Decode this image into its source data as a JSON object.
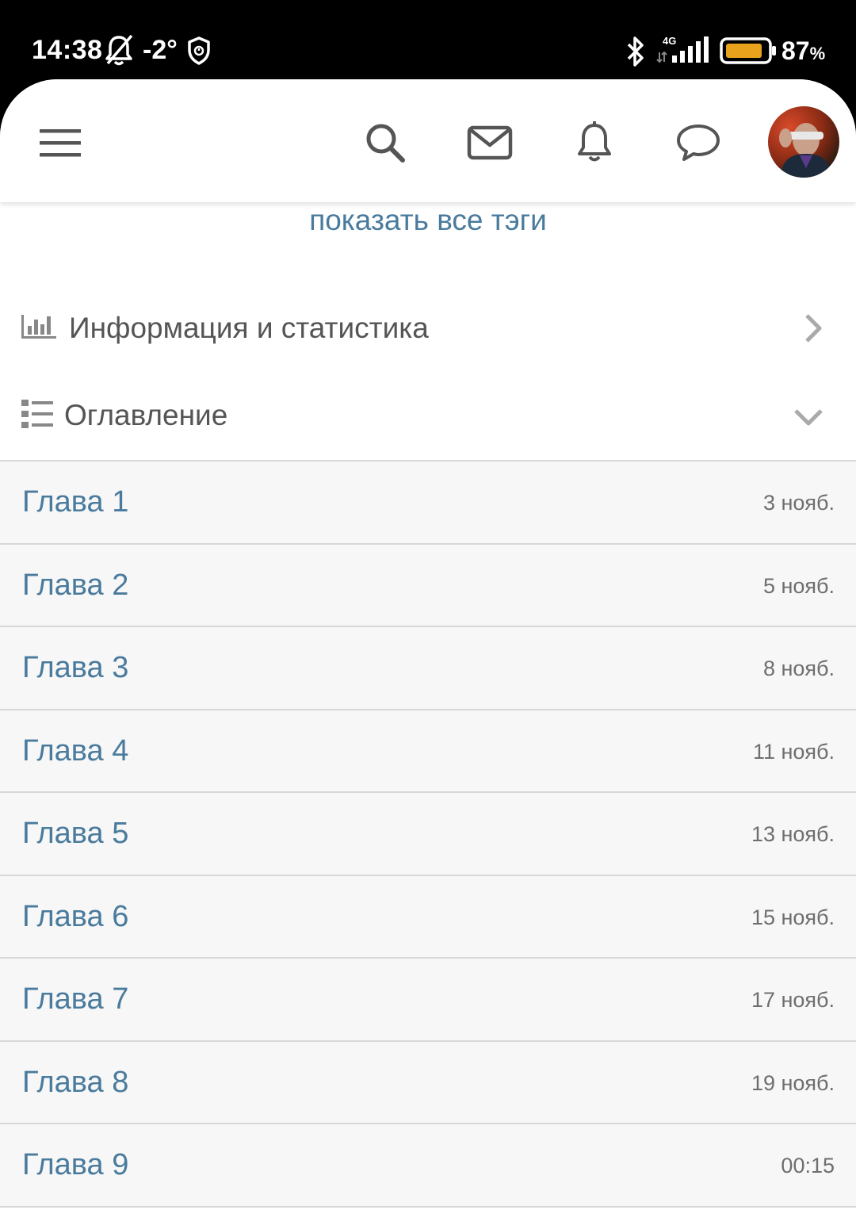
{
  "status_bar": {
    "time": "14:38",
    "temperature": "-2°",
    "network": "4G",
    "battery_percent": "87",
    "battery_unit": "%",
    "battery_level": 0.87,
    "icons": [
      "bell-muted-icon",
      "shield-icon",
      "bluetooth-icon",
      "signal-icon",
      "battery-icon"
    ]
  },
  "header": {
    "icons": [
      "menu-icon",
      "search-icon",
      "mail-icon",
      "bell-icon",
      "chat-icon",
      "avatar"
    ]
  },
  "content": {
    "show_tags_link": "показать все тэги",
    "info_section": {
      "label": "Информация и статистика",
      "icon": "bar-chart-icon",
      "state": "collapsed"
    },
    "toc_section": {
      "label": "Оглавление",
      "icon": "list-icon",
      "state": "expanded"
    },
    "chapters": [
      {
        "title": "Глава 1",
        "date": "3 нояб."
      },
      {
        "title": "Глава 2",
        "date": "5 нояб."
      },
      {
        "title": "Глава 3",
        "date": "8 нояб."
      },
      {
        "title": "Глава 4",
        "date": "11 нояб."
      },
      {
        "title": "Глава 5",
        "date": "13 нояб."
      },
      {
        "title": "Глава 6",
        "date": "15 нояб."
      },
      {
        "title": "Глава 7",
        "date": "17 нояб."
      },
      {
        "title": "Глава 8",
        "date": "19 нояб."
      },
      {
        "title": "Глава 9",
        "date": "00:15"
      }
    ]
  },
  "colors": {
    "link": "#4a7b9d",
    "row_bg": "#f7f7f7",
    "divider": "#d8d8d8",
    "icon_gray": "#555555",
    "battery_fill": "#e8a21c"
  }
}
